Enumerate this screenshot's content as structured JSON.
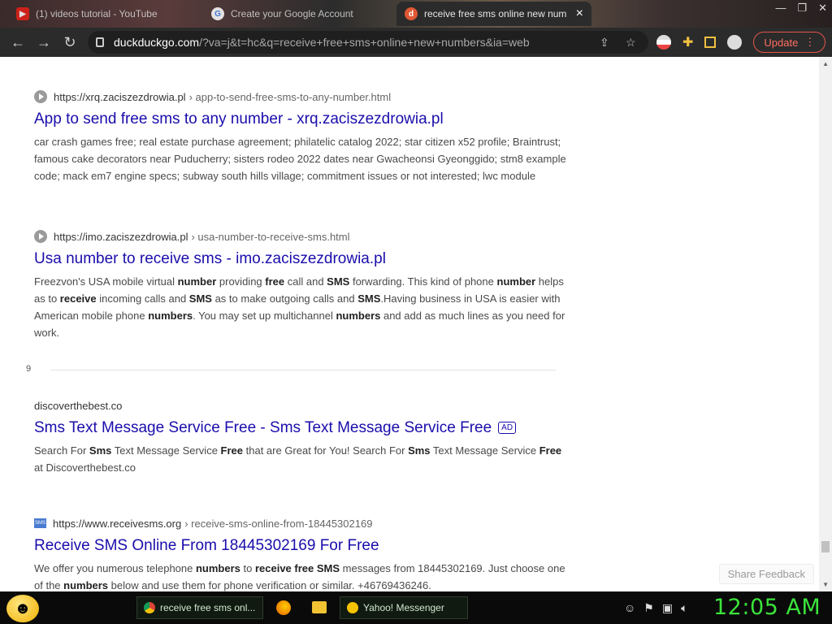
{
  "tabs": [
    {
      "label": "(1) videos tutorial - YouTube",
      "icon": "youtube-icon"
    },
    {
      "label": "Create your Google Account",
      "icon": "google-icon"
    },
    {
      "label": "receive free sms online new num",
      "icon": "duckduckgo-icon",
      "active": true
    }
  ],
  "address_bar": {
    "host": "duckduckgo.com",
    "path": "/?va=j&t=hc&q=receive+free+sms+online+new+numbers&ia=web"
  },
  "toolbar": {
    "update_label": "Update"
  },
  "results": [
    {
      "favicon": "circle-arrow-icon",
      "host": "https://xrq.zaciszezdrowia.pl",
      "path": "› app-to-send-free-sms-to-any-number.html",
      "title": "App to send free sms to any number - xrq.zaciszezdrowia.pl",
      "snippet": "car crash games free; real estate purchase agreement; philatelic catalog 2022; star citizen x52 profile; Braintrust; famous cake decorators near Puducherry; sisters rodeo 2022 dates near Gwacheonsi Gyeonggido; stm8 example code; mack em7 engine specs; subway south hills village; commitment issues or not interested; lwc module"
    },
    {
      "favicon": "circle-arrow-icon",
      "host": "https://imo.zaciszezdrowia.pl",
      "path": "› usa-number-to-receive-sms.html",
      "title": "Usa number to receive sms - imo.zaciszezdrowia.pl",
      "snippet_html": "Freezvon's USA mobile virtual <b>number</b> providing <b>free</b> call and <b>SMS</b> forwarding. This kind of phone <b>number</b> helps as to <b>receive</b> incoming calls and <b>SMS</b> as to make outgoing calls and <b>SMS</b>.Having business in USA is easier with American mobile phone <b>numbers</b>. You may set up multichannel <b>numbers</b> and add as much lines as you need for work."
    },
    {
      "host": "discoverthebest.co",
      "title": "Sms Text Message Service Free - Sms Text Message Service Free",
      "ad_label": "AD",
      "snippet_html": "Search For <b>Sms</b> Text Message Service <b>Free</b> that are Great for You! Search For <b>Sms</b> Text Message Service <b>Free</b> at Discoverthebest.co"
    },
    {
      "favicon": "sms-icon",
      "favicon_text": "SMS",
      "host": "https://www.receivesms.org",
      "path": "› receive-sms-online-from-18445302169",
      "title": "Receive SMS Online From 18445302169 For Free",
      "snippet_html": "We offer you numerous telephone <b>numbers</b> to <b>receive free SMS</b> messages from 18445302169. Just choose one of the <b>numbers</b> below and use them for phone verification or similar. +46769436246."
    }
  ],
  "page_number": "9",
  "share_feedback": "Share Feedback",
  "taskbar": {
    "tasks": [
      {
        "label": "receive free sms onl...",
        "icon": "chrome-icon"
      },
      {
        "label": "Yahoo! Messenger",
        "icon": "yahoo-messenger-icon"
      }
    ],
    "clock": "12:05 AM"
  }
}
